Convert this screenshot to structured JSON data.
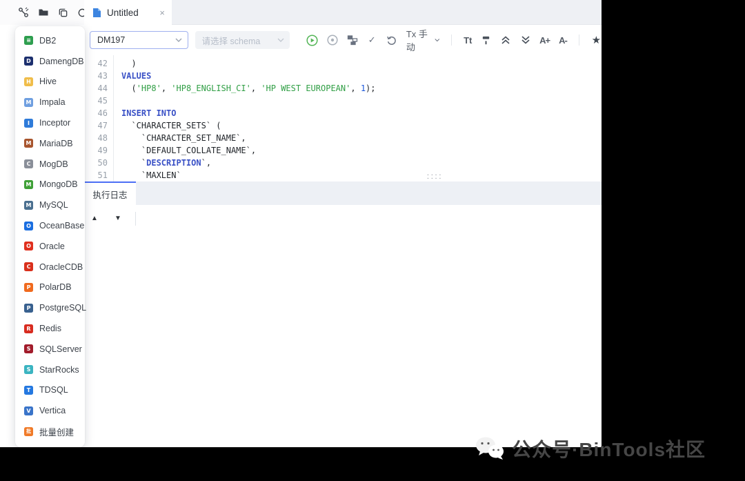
{
  "window": {
    "tab_title": "Untitled",
    "tab_close": "×"
  },
  "top_icons": [
    {
      "name": "connections-icon"
    },
    {
      "name": "folder-icon"
    },
    {
      "name": "copy-icon"
    },
    {
      "name": "refresh-icon"
    }
  ],
  "sidebar": {
    "items": [
      {
        "label": "DB2",
        "color": "#2e9e4f",
        "initial": "≡"
      },
      {
        "label": "DamengDB",
        "color": "#1c2f6e",
        "initial": "D"
      },
      {
        "label": "Hive",
        "color": "#f0bd4a",
        "initial": "H"
      },
      {
        "label": "Impala",
        "color": "#6f9fe0",
        "initial": "M"
      },
      {
        "label": "Inceptor",
        "color": "#2f7bd9",
        "initial": "I"
      },
      {
        "label": "MariaDB",
        "color": "#a8552e",
        "initial": "M"
      },
      {
        "label": "MogDB",
        "color": "#8a8f99",
        "initial": "C"
      },
      {
        "label": "MongoDB",
        "color": "#3fa037",
        "initial": "M"
      },
      {
        "label": "MySQL",
        "color": "#4a6f8f",
        "initial": "M"
      },
      {
        "label": "OceanBase",
        "color": "#1a6ee0",
        "initial": "O"
      },
      {
        "label": "Oracle",
        "color": "#e0301e",
        "initial": "O"
      },
      {
        "label": "OracleCDB",
        "color": "#d9301c",
        "initial": "C"
      },
      {
        "label": "PolarDB",
        "color": "#f06a1e",
        "initial": "P"
      },
      {
        "label": "PostgreSQL",
        "color": "#39618f",
        "initial": "P"
      },
      {
        "label": "Redis",
        "color": "#d82c20",
        "initial": "R"
      },
      {
        "label": "SQLServer",
        "color": "#a21c2b",
        "initial": "S"
      },
      {
        "label": "StarRocks",
        "color": "#3bb4c1",
        "initial": "S"
      },
      {
        "label": "TDSQL",
        "color": "#2478e0",
        "initial": "T"
      },
      {
        "label": "Vertica",
        "color": "#3a74c9",
        "initial": "V"
      },
      {
        "label": "批量创建",
        "color": "#f07a28",
        "initial": "批"
      }
    ]
  },
  "toolbar": {
    "connection_value": "DM197",
    "schema_placeholder": "请选择 schema",
    "tx_label": "Tx 手动",
    "check_glyph": "✓",
    "format_glyph": "Tt",
    "font_increase": "A+",
    "font_decrease": "A-",
    "star_glyph": "★"
  },
  "editor": {
    "colors": {
      "plain": "#1f2328",
      "keyword": "#3a51c6",
      "string": "#2f9e44",
      "number": "#1a56db"
    },
    "lines": [
      {
        "num": "42",
        "segments": [
          {
            "t": "  )",
            "c": "plain"
          }
        ]
      },
      {
        "num": "43",
        "segments": [
          {
            "t": "VALUES",
            "c": "keyword"
          }
        ]
      },
      {
        "num": "44",
        "segments": [
          {
            "t": "  (",
            "c": "plain"
          },
          {
            "t": "'HP8'",
            "c": "string"
          },
          {
            "t": ", ",
            "c": "plain"
          },
          {
            "t": "'HP8_ENGLISH_CI'",
            "c": "string"
          },
          {
            "t": ", ",
            "c": "plain"
          },
          {
            "t": "'HP WEST EUROPEAN'",
            "c": "string"
          },
          {
            "t": ", ",
            "c": "plain"
          },
          {
            "t": "1",
            "c": "number"
          },
          {
            "t": ");",
            "c": "plain"
          }
        ]
      },
      {
        "num": "45",
        "segments": []
      },
      {
        "num": "46",
        "segments": [
          {
            "t": "INSERT INTO",
            "c": "keyword"
          }
        ]
      },
      {
        "num": "47",
        "segments": [
          {
            "t": "  `CHARACTER_SETS` (",
            "c": "plain"
          }
        ]
      },
      {
        "num": "48",
        "segments": [
          {
            "t": "    `CHARACTER_SET_NAME`,",
            "c": "plain"
          }
        ]
      },
      {
        "num": "49",
        "segments": [
          {
            "t": "    `DEFAULT_COLLATE_NAME`,",
            "c": "plain"
          }
        ]
      },
      {
        "num": "50",
        "segments": [
          {
            "t": "    `",
            "c": "plain"
          },
          {
            "t": "DESCRIPTION",
            "c": "keyword"
          },
          {
            "t": "`,",
            "c": "plain"
          }
        ]
      },
      {
        "num": "51",
        "segments": [
          {
            "t": "    `MAXLEN`",
            "c": "plain"
          }
        ]
      }
    ],
    "drag_handle_glyph": "····\n····"
  },
  "bottom_panel": {
    "tab_label": "执行日志",
    "collapse_up": "▲",
    "collapse_down": "▼"
  },
  "watermark": {
    "text": "公众号·BinTools社区"
  }
}
